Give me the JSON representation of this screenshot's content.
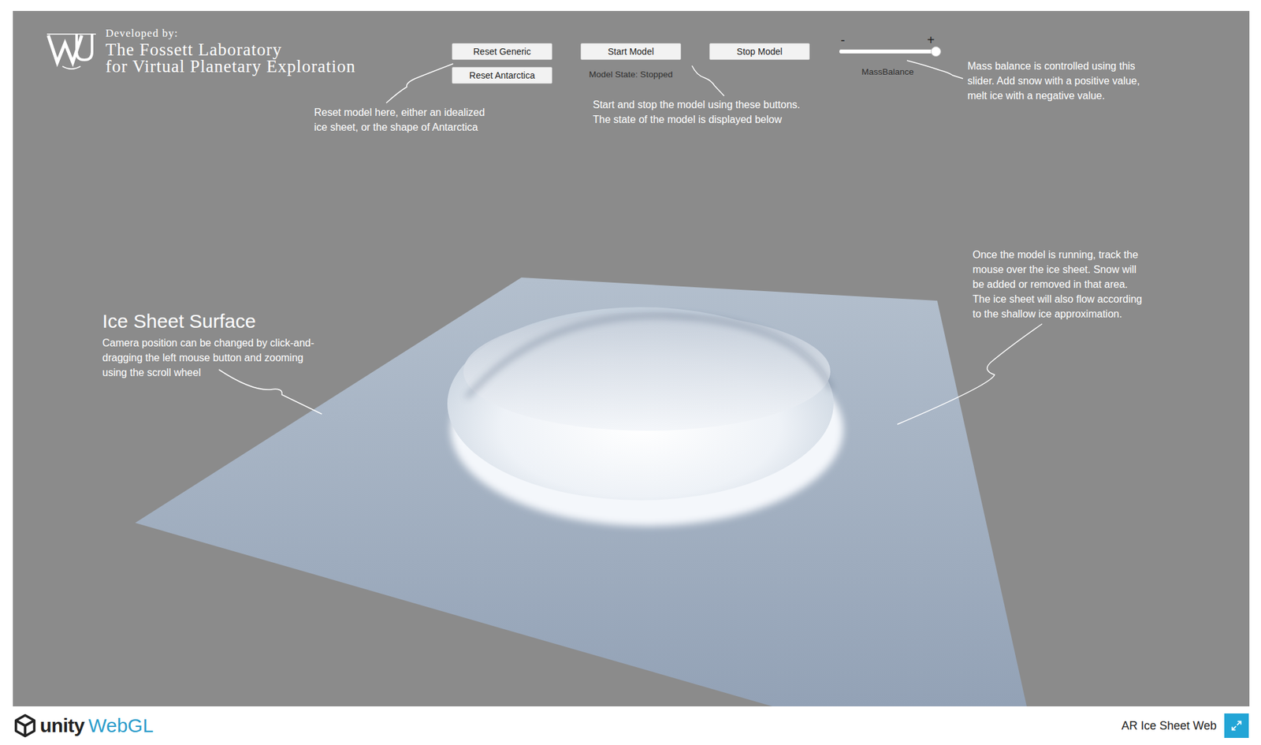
{
  "logo": {
    "developed_by": "Developed by:",
    "lab_lines": [
      "The Fossett Laboratory",
      "for Virtual Planetary Exploration"
    ]
  },
  "reset_buttons": [
    "Reset Generic",
    "Reset Antarctica"
  ],
  "model_buttons": [
    "Start Model",
    "Stop Model"
  ],
  "model_state": "Model State: Stopped",
  "slider": {
    "minus": "-",
    "plus": "+",
    "label": "MassBalance",
    "level": 1.0
  },
  "notes": {
    "reset": [
      "Reset model here, either an idealized",
      "ice sheet, or the shape of Antarctica"
    ],
    "model": [
      "Start and stop the model using these buttons.",
      "The state of the model is displayed below"
    ],
    "mass": [
      "Mass balance is controlled using this",
      "slider. Add snow with a positive value,",
      "melt ice with a negative value."
    ],
    "track": [
      "Once the model is running, track the",
      "mouse over the ice sheet. Snow will",
      "be added or removed in that area.",
      "The ice sheet will also flow according",
      "to the shallow ice approximation."
    ]
  },
  "surface": {
    "title": "Ice Sheet Surface",
    "lines": [
      "Camera position can be changed by click-and-",
      "dragging the left mouse button and zooming",
      "using the scroll wheel"
    ]
  },
  "footer": {
    "brand": "unity",
    "product": "WebGL",
    "title": "AR Ice Sheet Web"
  }
}
